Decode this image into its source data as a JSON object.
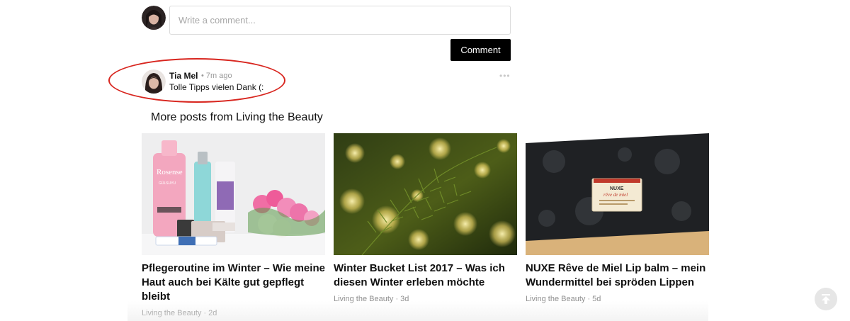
{
  "composer": {
    "placeholder": "Write a comment...",
    "value": "",
    "submit_label": "Comment"
  },
  "comment": {
    "author": "Tia Mel",
    "time": "• 7m ago",
    "text": "Tolle Tipps vielen Dank (:",
    "options_icon": "more-dots-icon"
  },
  "more_posts": {
    "heading": "More posts from Living the Beauty",
    "items": [
      {
        "title": "Pflegeroutine im Winter – Wie meine Haut auch bei Kälte gut gepflegt bleibt",
        "source": "Living the Beauty",
        "age": "2d",
        "meta": "Living the Beauty · 2d",
        "image_label": "Rosense",
        "image_sub": "GÜLSUYU"
      },
      {
        "title": "Winter Bucket List 2017 – Was ich diesen Winter erleben möchte",
        "source": "Living the Beauty",
        "age": "3d",
        "meta": "Living the Beauty · 3d"
      },
      {
        "title": "NUXE Rêve de Miel Lip balm – mein Wundermittel bei spröden Lippen",
        "source": "Living the Beauty",
        "age": "5d",
        "meta": "Living the Beauty · 5d",
        "image_label": "NUXE",
        "image_sub": "rêve de miel"
      }
    ]
  },
  "back_to_top": {
    "icon": "arrow-up-to-top-icon"
  },
  "colors": {
    "highlight": "#d8261f",
    "button_bg": "#000000",
    "meta_text": "#8f8f8f"
  }
}
